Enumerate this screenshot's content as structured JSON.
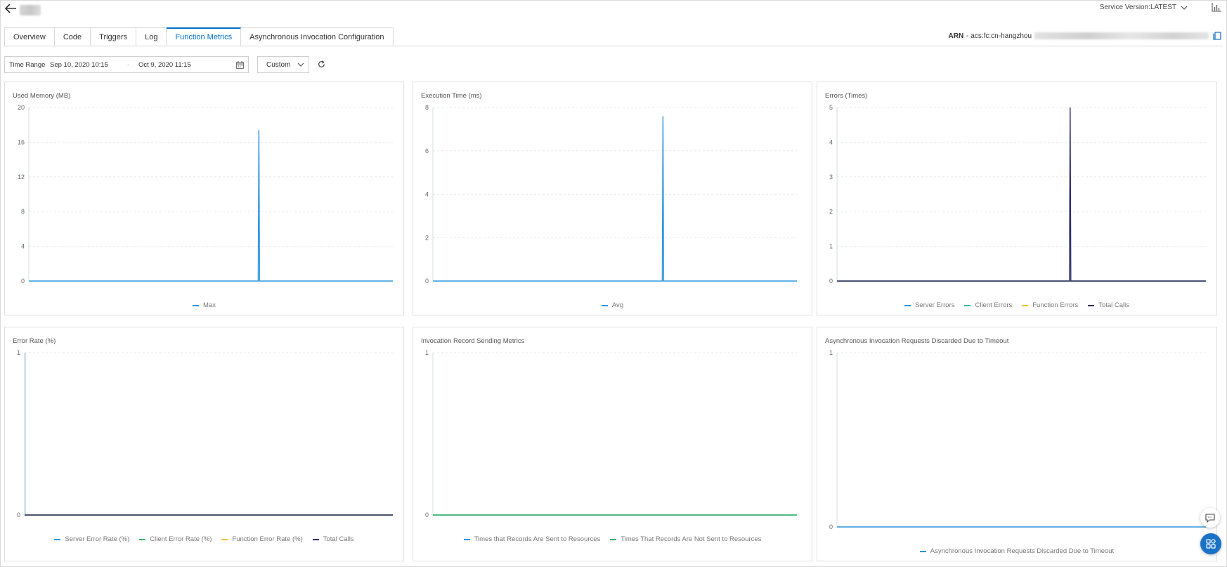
{
  "header": {
    "service_version_label": "Service Version:LATEST"
  },
  "tabs": [
    {
      "label": "Overview",
      "active": false
    },
    {
      "label": "Code",
      "active": false
    },
    {
      "label": "Triggers",
      "active": false
    },
    {
      "label": "Log",
      "active": false
    },
    {
      "label": "Function Metrics",
      "active": true
    },
    {
      "label": "Asynchronous Invocation Configuration",
      "active": false
    }
  ],
  "arn": {
    "label": "ARN",
    "prefix": "- acs:fc:cn-hangzhou"
  },
  "toolbar": {
    "time_range_label": "Time Range",
    "start": "Sep 10, 2020 10:15",
    "separator": "-",
    "end": "Oct 9, 2020 11:15",
    "range_select_value": "Custom"
  },
  "colors": {
    "accent": "#0070cc",
    "blue": "#2f95e0",
    "cyan": "#3ab8a8",
    "green": "#35b45f",
    "yellow": "#f2c12e",
    "navy": "#2b2d6e"
  },
  "chart_data": [
    {
      "type": "line",
      "title": "Used Memory (MB)",
      "ylim": [
        0,
        20
      ],
      "yticks": [
        "0",
        "4",
        "8",
        "12",
        "16",
        "20"
      ],
      "series": [
        {
          "name": "Max",
          "color": "#2f95e0",
          "spike_x": 0.632,
          "spike_value": 17.4
        }
      ],
      "legend": "bottom-center",
      "grid": true
    },
    {
      "type": "line",
      "title": "Execution Time (ms)",
      "ylim": [
        0,
        8
      ],
      "yticks": [
        "0",
        "2",
        "4",
        "6",
        "8"
      ],
      "series": [
        {
          "name": "Avg",
          "color": "#2f95e0",
          "spike_x": 0.632,
          "spike_value": 7.6
        }
      ],
      "legend": "bottom-center",
      "grid": true
    },
    {
      "type": "line",
      "title": "Errors (Times)",
      "ylim": [
        0,
        5
      ],
      "yticks": [
        "0",
        "1",
        "2",
        "3",
        "4",
        "5"
      ],
      "series": [
        {
          "name": "Server Errors",
          "color": "#2f95e0"
        },
        {
          "name": "Client Errors",
          "color": "#3ab8a8"
        },
        {
          "name": "Function Errors",
          "color": "#f2c12e"
        },
        {
          "name": "Total Calls",
          "color": "#2b2d6e",
          "spike_x": 0.632,
          "spike_value": 5
        }
      ],
      "legend": "bottom-center",
      "grid": true
    },
    {
      "type": "line",
      "title": "Error Rate (%)",
      "ylim": [
        0,
        1
      ],
      "yticks": [
        "0",
        "1"
      ],
      "series": [
        {
          "name": "Server Error Rate (%)",
          "color": "#2f95e0"
        },
        {
          "name": "Client Error Rate (%)",
          "color": "#35b45f"
        },
        {
          "name": "Function Error Rate (%)",
          "color": "#f2c12e"
        },
        {
          "name": "Total Calls",
          "color": "#2b2d6e"
        }
      ],
      "legend": "bottom-center",
      "grid": true
    },
    {
      "type": "line",
      "title": "Invocation Record Sending Metrics",
      "ylim": [
        0,
        1
      ],
      "yticks": [
        "0",
        "1"
      ],
      "series": [
        {
          "name": "Times that Records Are Sent to Resources",
          "color": "#2f95e0"
        },
        {
          "name": "Times That Records Are Not Sent to Resources",
          "color": "#35b45f"
        }
      ],
      "legend": "bottom-center",
      "grid": true
    },
    {
      "type": "line",
      "title": "Asynchronous Invocation Requests Discarded Due to Timeout",
      "ylim": [
        0,
        1
      ],
      "yticks": [
        "0",
        "1"
      ],
      "series": [
        {
          "name": "Asynchronous Invocation Requests Discarded Due to Timeout",
          "color": "#2f95e0"
        }
      ],
      "legend": "bottom-center",
      "grid": true
    }
  ]
}
